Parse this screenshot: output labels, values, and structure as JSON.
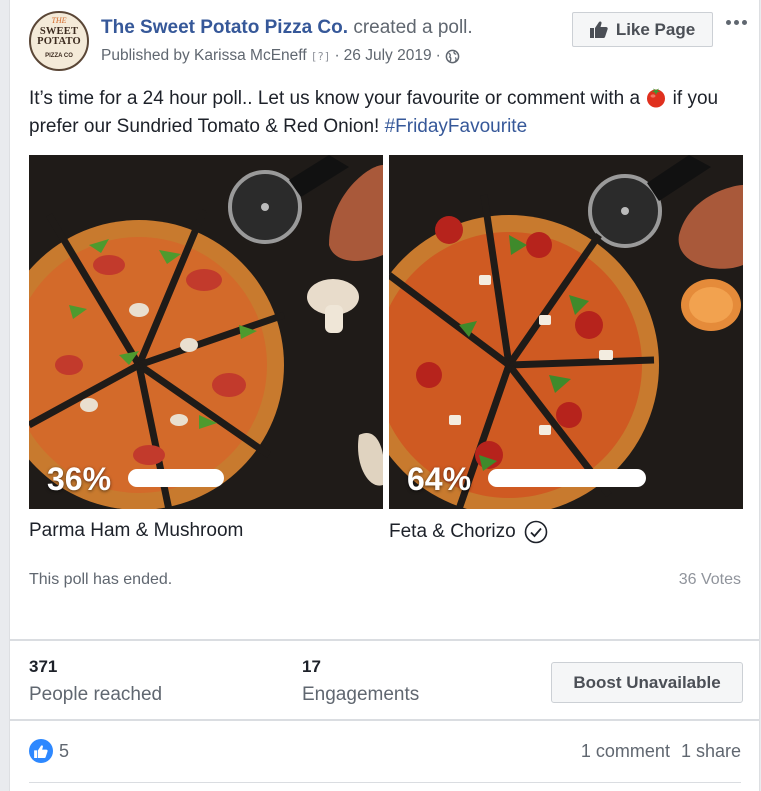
{
  "post": {
    "page_name": "The Sweet Potato Pizza Co.",
    "action": "created a poll.",
    "published_by": "Published by Karissa McEneff",
    "help_mark": "[?]",
    "separator": "·",
    "date": "26 July 2019",
    "like_page_label": "Like Page",
    "text_before": "It’s time for a 24 hour poll.. Let us know your favourite or comment with a",
    "text_after": "if you prefer our Sundried Tomato & Red Onion!",
    "hashtag": "#FridayFavourite"
  },
  "avatar": {
    "the": "THE",
    "line1": "SWEET",
    "line2": "POTATO",
    "sub": "PIZZA CO"
  },
  "poll": {
    "options": [
      {
        "label": "Parma Ham & Mushroom",
        "percent_label": "36%",
        "percent": 36,
        "winner": false
      },
      {
        "label": "Feta & Chorizo",
        "percent_label": "64%",
        "percent": 64,
        "winner": true
      }
    ],
    "status": "This poll has ended.",
    "votes": "36 Votes"
  },
  "insights": {
    "reached_value": "371",
    "reached_label": "People reached",
    "engagements_value": "17",
    "engagements_label": "Engagements",
    "boost_label": "Boost Unavailable"
  },
  "social": {
    "likes": "5",
    "comments": "1 comment",
    "shares": "1 share"
  },
  "colors": {
    "page_link": "#365899",
    "like_blue": "#2d88ff",
    "muted": "#606770"
  },
  "icons": {
    "like_page": "thumbs-up-icon",
    "privacy": "globe-icon",
    "emoji": "tomato-icon",
    "winner": "check-circle-icon",
    "reaction": "like-reaction-icon"
  }
}
